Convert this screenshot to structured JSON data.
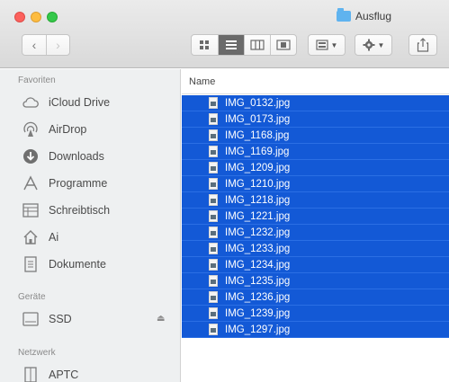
{
  "window": {
    "title": "Ausflug"
  },
  "toolbar": {
    "back_glyph": "‹",
    "forward_glyph": "›"
  },
  "sidebar": {
    "favorites_header": "Favoriten",
    "favorites": [
      {
        "label": "iCloud Drive",
        "icon": "cloud-icon"
      },
      {
        "label": "AirDrop",
        "icon": "airdrop-icon"
      },
      {
        "label": "Downloads",
        "icon": "downloads-icon"
      },
      {
        "label": "Programme",
        "icon": "applications-icon"
      },
      {
        "label": "Schreibtisch",
        "icon": "desktop-icon"
      },
      {
        "label": "Ai",
        "icon": "home-icon"
      },
      {
        "label": "Dokumente",
        "icon": "documents-icon"
      }
    ],
    "devices_header": "Geräte",
    "devices": [
      {
        "label": "SSD",
        "icon": "drive-icon"
      }
    ],
    "network_header": "Netzwerk",
    "network": [
      {
        "label": "APTC",
        "icon": "network-icon"
      }
    ]
  },
  "list": {
    "column_name": "Name",
    "files": [
      "IMG_0132.jpg",
      "IMG_0173.jpg",
      "IMG_1168.jpg",
      "IMG_1169.jpg",
      "IMG_1209.jpg",
      "IMG_1210.jpg",
      "IMG_1218.jpg",
      "IMG_1221.jpg",
      "IMG_1232.jpg",
      "IMG_1233.jpg",
      "IMG_1234.jpg",
      "IMG_1235.jpg",
      "IMG_1236.jpg",
      "IMG_1239.jpg",
      "IMG_1297.jpg"
    ]
  },
  "colors": {
    "selection": "#1359d6",
    "sidebar": "#eef0f1"
  }
}
